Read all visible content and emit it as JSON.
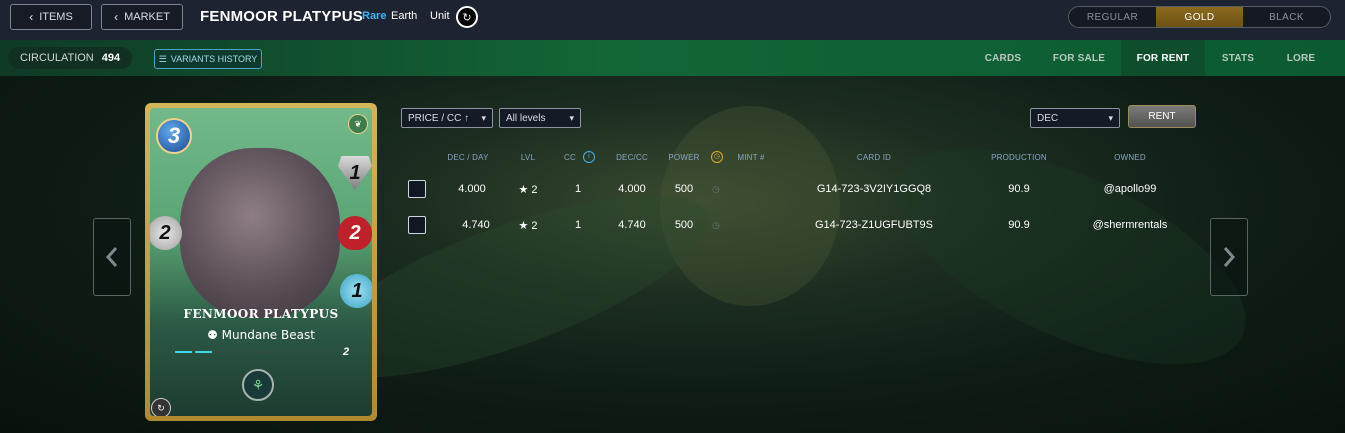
{
  "header": {
    "items_label": "ITEMS",
    "market_label": "MARKET",
    "card_name": "FENMOOR PLATYPUS",
    "rarity": "Rare",
    "element": "Earth",
    "unit_label": "Unit",
    "foils": [
      "REGULAR",
      "GOLD",
      "BLACK"
    ],
    "active_foil": "GOLD"
  },
  "subbar": {
    "circulation_label": "CIRCULATION",
    "circulation_value": "494",
    "variants_label": "VARIANTS HISTORY",
    "tabs": [
      "CARDS",
      "FOR SALE",
      "FOR RENT",
      "STATS",
      "LORE"
    ],
    "active_tab": "FOR RENT"
  },
  "filters": {
    "sort": "PRICE / CC ↑",
    "levels": "All levels",
    "currency": "DEC",
    "rent_label": "RENT"
  },
  "table": {
    "headers": [
      "DEC / DAY",
      "LVL",
      "CC",
      "DEC/CC",
      "POWER",
      "MINT #",
      "CARD ID",
      "PRODUCTION",
      "OWNED"
    ],
    "rows": [
      {
        "dec_day": "4.000",
        "lvl": "★ 2",
        "cc": "1",
        "dec_cc": "4.000",
        "power": "500",
        "card_id": "G14-723-3V2IY1GGQ8",
        "production": "90.9",
        "owned": "@apollo99"
      },
      {
        "dec_day": "4.740",
        "lvl": "★ 2",
        "cc": "1",
        "dec_cc": "4.740",
        "power": "500",
        "card_id": "G14-723-Z1UGFUBT9S",
        "production": "90.9",
        "owned": "@shermrentals"
      }
    ]
  },
  "card": {
    "mana": "3",
    "armor": "1",
    "melee": "2",
    "health": "2",
    "speed": "1",
    "name": "FENMOOR PLATYPUS",
    "type": "Mundane Beast",
    "level": "2",
    "level_progress": 0.125
  },
  "colors": {
    "accent_blue": "#3fb2f2",
    "gold": "#8c6a1e",
    "tab_active": "#0f4e2d"
  }
}
